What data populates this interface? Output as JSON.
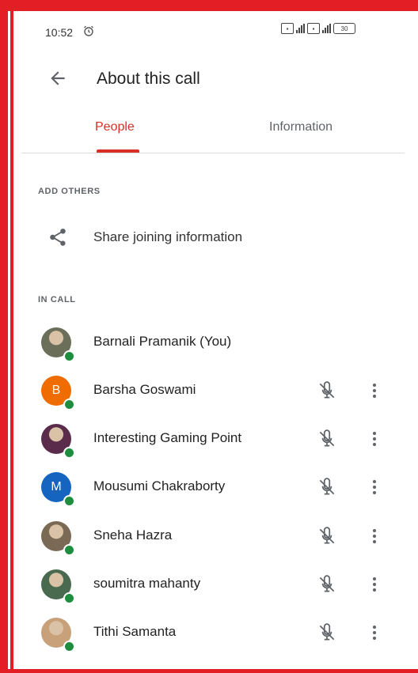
{
  "status_bar": {
    "time": "10:52",
    "battery": "30"
  },
  "header": {
    "title": "About this call"
  },
  "tabs": [
    {
      "label": "People",
      "active": true
    },
    {
      "label": "Information",
      "active": false
    }
  ],
  "sections": {
    "add_others": "ADD OTHERS",
    "in_call": "IN CALL"
  },
  "share": {
    "label": "Share joining information"
  },
  "participants": [
    {
      "name": "Barnali Pramanik (You)",
      "avatar": "photo",
      "initial": "",
      "color": "#6b6f5a",
      "controls": false
    },
    {
      "name": "Barsha Goswami",
      "avatar": "letter",
      "initial": "B",
      "color": "#ef6c00",
      "controls": true
    },
    {
      "name": "Interesting Gaming Point",
      "avatar": "photo",
      "initial": "",
      "color": "#5a2b4a",
      "controls": true
    },
    {
      "name": "Mousumi Chakraborty",
      "avatar": "letter",
      "initial": "M",
      "color": "#1565c0",
      "controls": true
    },
    {
      "name": "Sneha Hazra",
      "avatar": "photo",
      "initial": "",
      "color": "#7a6a55",
      "controls": true
    },
    {
      "name": "soumitra mahanty",
      "avatar": "photo",
      "initial": "",
      "color": "#4a6a50",
      "controls": true
    },
    {
      "name": "Tithi Samanta",
      "avatar": "photo",
      "initial": "",
      "color": "#c8a07a",
      "controls": true
    }
  ],
  "colors": {
    "accent": "#d93025",
    "online": "#1e8e3e",
    "border": "#e31e24"
  }
}
